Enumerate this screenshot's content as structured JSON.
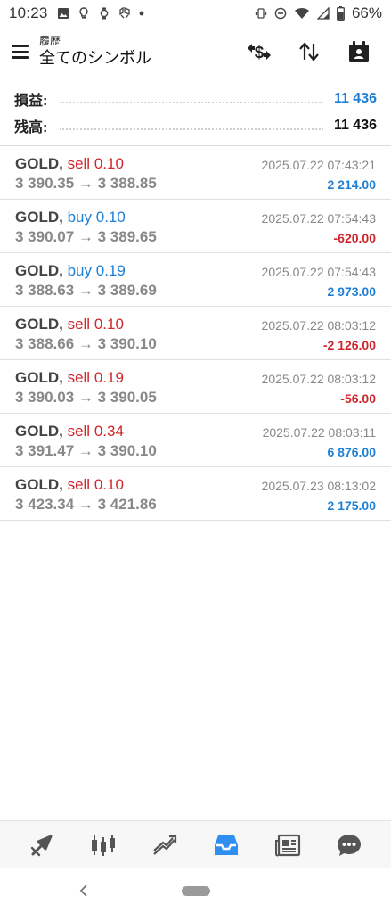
{
  "status_bar": {
    "time": "10:23",
    "battery": "66%",
    "left_icons": [
      "image-icon",
      "bulb-icon",
      "watch-icon",
      "app-icon",
      "dot-icon"
    ],
    "right_icons": [
      "vibrate-icon",
      "dnd-icon",
      "wifi-icon",
      "signal-icon",
      "battery-icon"
    ]
  },
  "header": {
    "subtitle": "履歴",
    "title": "全てのシンボル",
    "actions": [
      "currency-exchange-icon",
      "sort-icon",
      "calendar-icon"
    ]
  },
  "summary": {
    "profit_label": "損益:",
    "profit_value": "11 436",
    "balance_label": "残高:",
    "balance_value": "11 436"
  },
  "trades": [
    {
      "symbol": "GOLD,",
      "side": "sell",
      "volume": "0.10",
      "prices": "3 390.35 → 3 388.85",
      "time": "2025.07.22 07:43:21",
      "profit": "2 214.00",
      "positive": true
    },
    {
      "symbol": "GOLD,",
      "side": "buy",
      "volume": "0.10",
      "prices": "3 390.07 → 3 389.65",
      "time": "2025.07.22 07:54:43",
      "profit": "-620.00",
      "positive": false
    },
    {
      "symbol": "GOLD,",
      "side": "buy",
      "volume": "0.19",
      "prices": "3 388.63 → 3 389.69",
      "time": "2025.07.22 07:54:43",
      "profit": "2 973.00",
      "positive": true
    },
    {
      "symbol": "GOLD,",
      "side": "sell",
      "volume": "0.10",
      "prices": "3 388.66 → 3 390.10",
      "time": "2025.07.22 08:03:12",
      "profit": "-2 126.00",
      "positive": false
    },
    {
      "symbol": "GOLD,",
      "side": "sell",
      "volume": "0.19",
      "prices": "3 390.03 → 3 390.05",
      "time": "2025.07.22 08:03:12",
      "profit": "-56.00",
      "positive": false
    },
    {
      "symbol": "GOLD,",
      "side": "sell",
      "volume": "0.34",
      "prices": "3 391.47 → 3 390.10",
      "time": "2025.07.22 08:03:11",
      "profit": "6 876.00",
      "positive": true
    },
    {
      "symbol": "GOLD,",
      "side": "sell",
      "volume": "0.10",
      "prices": "3 423.34 → 3 421.86",
      "time": "2025.07.23 08:13:02",
      "profit": "2 175.00",
      "positive": true
    }
  ],
  "bottom_nav": {
    "items": [
      "quotes-icon",
      "chart-icon",
      "trade-icon",
      "history-icon",
      "news-icon",
      "chat-icon"
    ],
    "active": "history-icon",
    "active_color": "#2f8ff0",
    "inactive_color": "#555555"
  },
  "colors": {
    "sell": "#d0262b",
    "buy": "#1e7fd6",
    "profit_positive": "#1e7fd6",
    "profit_negative": "#d0262b"
  }
}
